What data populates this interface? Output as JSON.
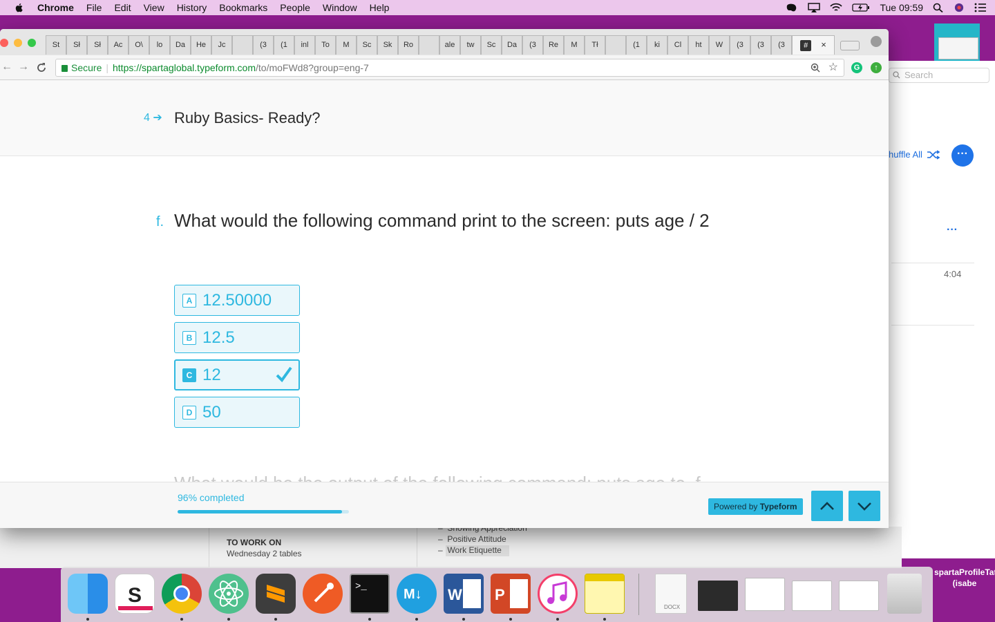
{
  "menubar": {
    "app": "Chrome",
    "menus": [
      "File",
      "Edit",
      "View",
      "History",
      "Bookmarks",
      "People",
      "Window",
      "Help"
    ],
    "clock": "Tue 09:59"
  },
  "browser": {
    "tabs": [
      "St",
      "Sł",
      "Sł",
      "Ac",
      "O\\",
      "lo",
      "Da",
      "He",
      "Jc",
      "",
      "(3",
      "(1",
      "inl",
      "To",
      "M",
      "Sc",
      "Sk",
      "Ro",
      "",
      "ale",
      "tw",
      "Sc",
      "Da",
      "(3",
      "Re",
      "M",
      "Tł",
      "",
      "(1",
      "ki",
      "Cl",
      "ht",
      "W",
      "(3",
      "(3",
      "(3"
    ],
    "url": {
      "secure_label": "Secure",
      "host": "https://spartaglobal.typeform.com",
      "path": "/to/moFWd8?group=eng-7"
    }
  },
  "form": {
    "previous": {
      "number": "4",
      "title": "Ruby Basics- Ready?"
    },
    "question": {
      "letter": "f.",
      "text": "What would the following command print to the screen: puts age / 2"
    },
    "choices": [
      {
        "key": "A",
        "label": "12.50000"
      },
      {
        "key": "B",
        "label": "12.5"
      },
      {
        "key": "C",
        "label": "12",
        "selected": true
      },
      {
        "key": "D",
        "label": "50"
      }
    ],
    "next_question_peek": "What would be the output of the following command: puts age.to_f",
    "progress": {
      "text": "96% completed",
      "fraction": 0.96
    },
    "powered_by": {
      "prefix": "Powered by ",
      "brand": "Typeform"
    },
    "accent": "#2eb8e0"
  },
  "background_window": {
    "search_placeholder": "Search",
    "shuffle_label": "huffle All",
    "time": "4:04"
  },
  "background_doc": {
    "heading": "TO WORK ON",
    "subtext": "Wednesday   2 tables",
    "list": [
      "Showing Appreciation",
      "Positive Attitude",
      "Work Etiquette"
    ]
  },
  "desktop": {
    "file_label": "spartaProfileTate (isabe",
    "dock_doc_label": "DOCX"
  }
}
